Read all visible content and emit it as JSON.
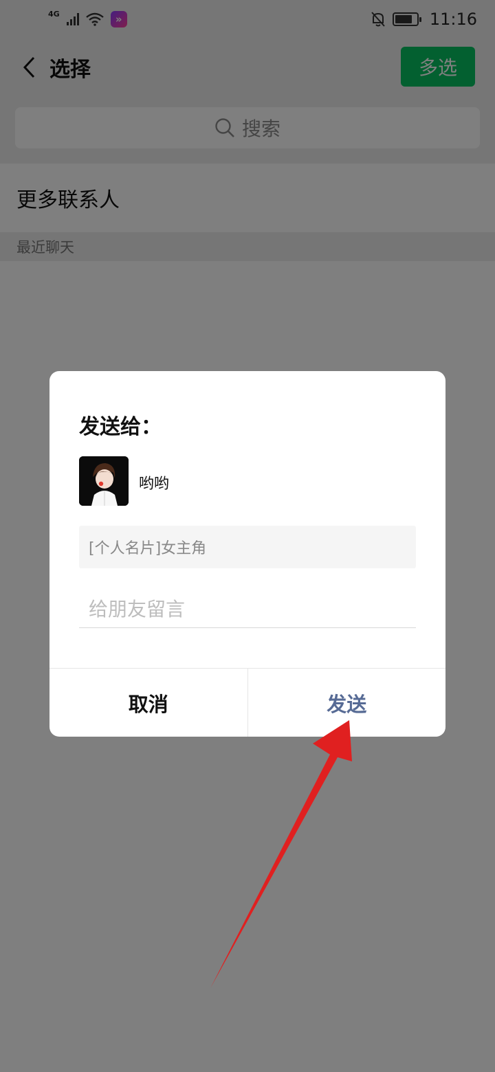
{
  "status_bar": {
    "network_label": "4G",
    "time": "11:16",
    "battery_level": 0.8,
    "icons": [
      "signal-icon",
      "wifi-icon",
      "app-notification-icon",
      "mute-icon",
      "battery-icon"
    ]
  },
  "header": {
    "title": "选择",
    "multi_select_label": "多选"
  },
  "search": {
    "placeholder": "搜索"
  },
  "list": {
    "more_contacts": "更多联系人",
    "recent_chats_header": "最近聊天"
  },
  "dialog": {
    "title": "发送给：",
    "recipient_name": "哟哟",
    "card_preview": "[个人名片]女主角",
    "message_placeholder": "给朋友留言",
    "cancel_label": "取消",
    "send_label": "发送"
  },
  "colors": {
    "accent_green": "#07c160",
    "send_blue": "#576b95",
    "arrow_red": "#e02020"
  }
}
